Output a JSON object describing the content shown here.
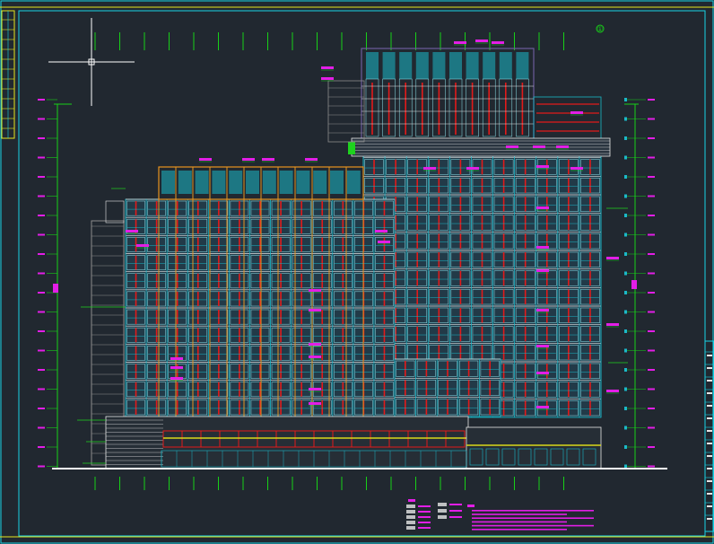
{
  "drawing": {
    "background": "#212830",
    "colors": {
      "frame_cyan": "#19d3e6",
      "frame_yellow": "#e6e61e",
      "grid_green": "#18d018",
      "glass_cyan": "#1bb8c8",
      "glass_light": "#8fe6f0",
      "mullion_red": "#e21a1a",
      "fin_orange": "#e8931e",
      "slab_white": "#e6e6e6",
      "annotation_magenta": "#e21ee6",
      "structure_grey": "#8d8d8d",
      "top_band_purple": "#6c5c9c",
      "leader_green": "#1ed21e",
      "base_yellow": "#d9d91a",
      "ground_white": "#ffffff"
    },
    "axis_markers_top_count": 20,
    "axis_markers_bottom_count": 20,
    "axis_bubble": "①",
    "level_tick_count_left": 20,
    "level_tick_count_right": 20
  }
}
